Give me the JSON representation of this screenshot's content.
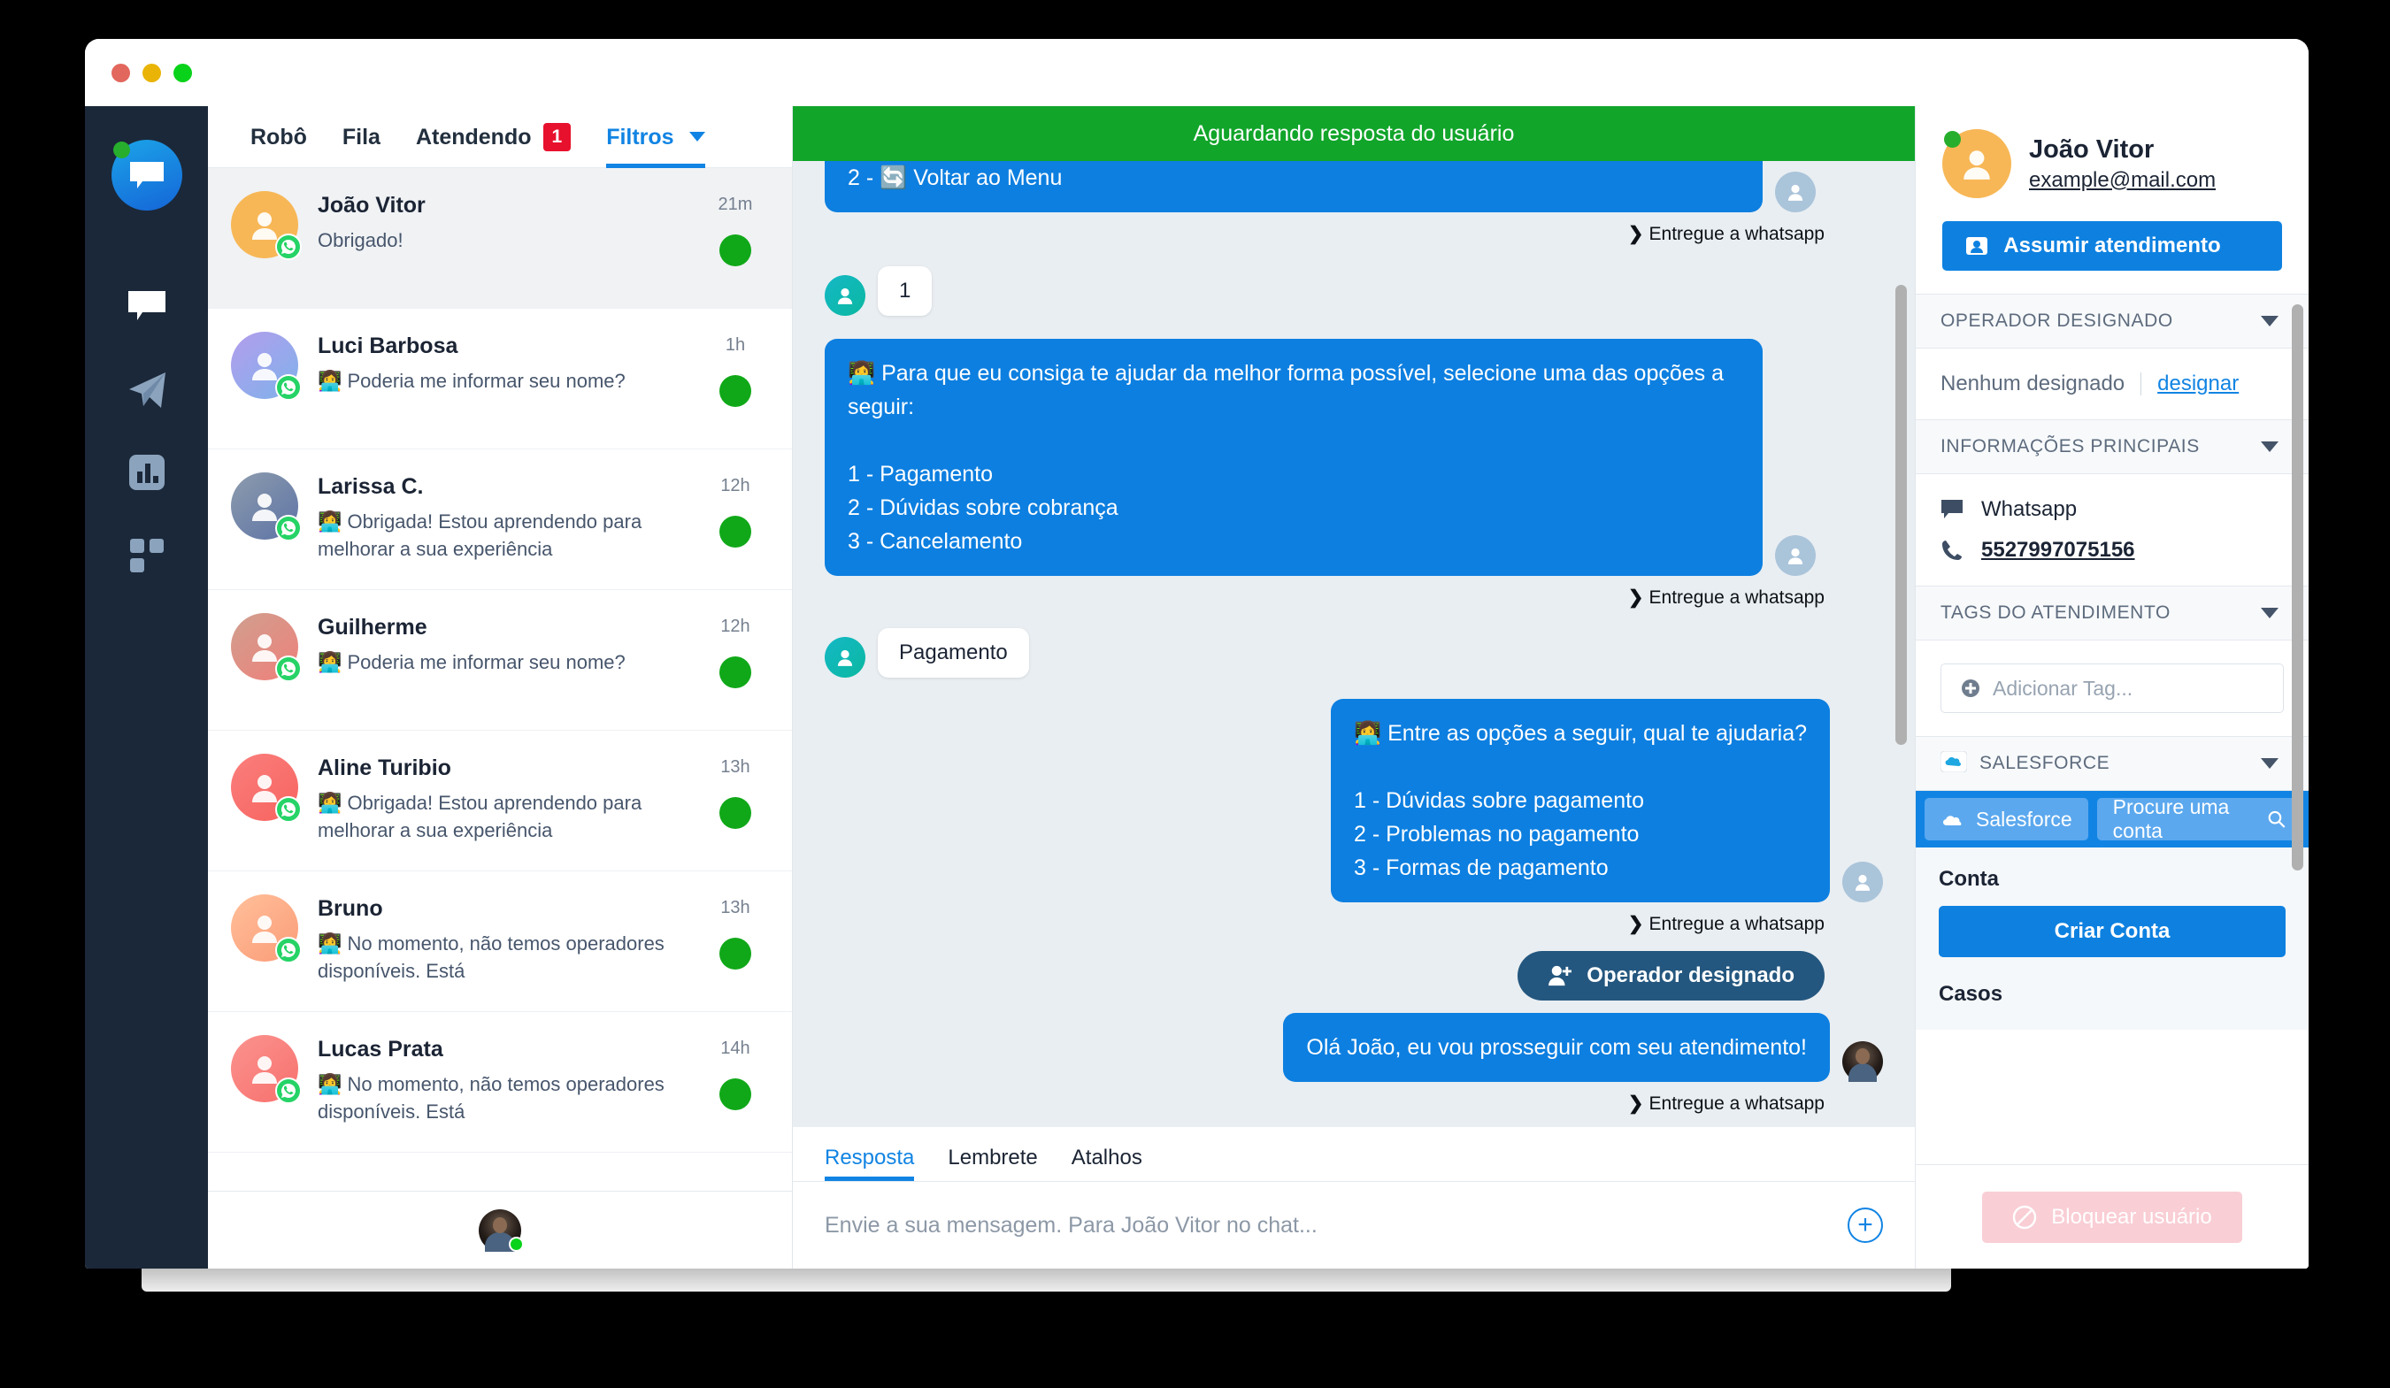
{
  "window": {
    "traffic_lights": [
      "close",
      "minimize",
      "maximize"
    ]
  },
  "rail": {
    "logo_icon": "chat-logo-icon",
    "items": [
      {
        "icon": "chat-bubble-icon",
        "name": "nav-chat"
      },
      {
        "icon": "paper-plane-icon",
        "name": "nav-campaigns"
      },
      {
        "icon": "bar-chart-icon",
        "name": "nav-reports"
      },
      {
        "icon": "apps-grid-icon",
        "name": "nav-apps"
      }
    ]
  },
  "tabs": [
    {
      "label": "Robô",
      "active": false,
      "badge": ""
    },
    {
      "label": "Fila",
      "active": false,
      "badge": ""
    },
    {
      "label": "Atendendo",
      "active": false,
      "badge": "1"
    },
    {
      "label": "Filtros",
      "active": true,
      "badge": "",
      "caret": true
    }
  ],
  "conversations": [
    {
      "name": "João Vitor",
      "snippet": "Obrigado!",
      "time": "21m",
      "selected": true,
      "avatar_color": "#f7b756",
      "channel": "whatsapp",
      "status_color": "#10a818"
    },
    {
      "name": "Luci Barbosa",
      "snippet": "👩‍💻 Poderia me informar seu nome?",
      "time": "1h",
      "selected": false,
      "avatar_color": "#9aa5e8",
      "channel": "whatsapp",
      "status_color": "#10a818"
    },
    {
      "name": "Larissa C.",
      "snippet": "👩‍💻 Obrigada! Estou aprendendo para melhorar a sua experiência",
      "time": "12h",
      "selected": false,
      "avatar_color": "#6f7f9e",
      "channel": "whatsapp",
      "status_color": "#10a818"
    },
    {
      "name": "Guilherme",
      "snippet": "👩‍💻 Poderia me informar seu nome?",
      "time": "12h",
      "selected": false,
      "avatar_color": "#d98a86",
      "channel": "whatsapp",
      "status_color": "#10a818"
    },
    {
      "name": "Aline Turibio",
      "snippet": "👩‍💻 Obrigada! Estou aprendendo para melhorar a sua experiência",
      "time": "13h",
      "selected": false,
      "avatar_color": "#f8766f",
      "channel": "whatsapp",
      "status_color": "#10a818"
    },
    {
      "name": "Bruno",
      "snippet": "👩‍💻 No momento, não temos operadores disponíveis. Está",
      "time": "13h",
      "selected": false,
      "avatar_color": "#fbab82",
      "channel": "whatsapp",
      "status_color": "#10a818"
    },
    {
      "name": "Lucas Prata",
      "snippet": "👩‍💻 No momento, não temos operadores disponíveis. Está",
      "time": "14h",
      "selected": false,
      "avatar_color": "#f98e8b",
      "channel": "whatsapp",
      "status_color": "#10a818"
    }
  ],
  "chat": {
    "status_banner": "Aguardando resposta do usuário",
    "delivery_label": "Entregue a whatsapp",
    "messages": [
      {
        "type": "bot",
        "text": "2 - 🔄 Voltar ao Menu",
        "clipped": true,
        "delivery": "Entregue a whatsapp"
      },
      {
        "type": "user_pill",
        "text": "1"
      },
      {
        "type": "bot",
        "text": "👩‍💻 Para que eu consiga te ajudar da melhor forma possível, selecione uma das opções a seguir:\n\n1 - Pagamento\n2 - Dúvidas sobre cobrança\n3 - Cancelamento",
        "delivery": "Entregue a whatsapp"
      },
      {
        "type": "user_pill",
        "text": "Pagamento"
      },
      {
        "type": "bot_right",
        "text": "👩‍💻 Entre as opções a seguir, qual te ajudaria?\n\n1 - Dúvidas sobre pagamento\n2 - Problemas no pagamento\n3 - Formas de pagamento",
        "delivery": "Entregue a whatsapp"
      },
      {
        "type": "system",
        "text": "Operador designado",
        "icon": "user-plus-icon"
      },
      {
        "type": "operator",
        "text": "Olá João, eu vou prosseguir com seu atendimento!",
        "delivery": "Entregue a whatsapp"
      }
    ]
  },
  "compose": {
    "tabs": [
      {
        "label": "Resposta",
        "active": true
      },
      {
        "label": "Lembrete",
        "active": false
      },
      {
        "label": "Atalhos",
        "active": false
      }
    ],
    "placeholder": "Envie a sua mensagem. Para João Vitor no chat...",
    "attach_icon": "plus-circle-icon"
  },
  "sidebar": {
    "contact_name": "João Vitor",
    "contact_email": "example@mail.com",
    "assume_button": "Assumir atendimento",
    "sections": {
      "operator": {
        "title": "OPERADOR DESIGNADO",
        "none_label": "Nenhum designado",
        "assign_link": "designar"
      },
      "info": {
        "title": "INFORMAÇÕES PRINCIPAIS",
        "channel_label": "Whatsapp",
        "phone": "5527997075156"
      },
      "tags": {
        "title": "TAGS DO ATENDIMENTO",
        "add_placeholder": "Adicionar Tag..."
      },
      "salesforce": {
        "title": "SALESFORCE",
        "chip_label": "Salesforce",
        "search_placeholder": "Procure uma conta",
        "account_label": "Conta",
        "create_button": "Criar Conta",
        "cases_label": "Casos"
      }
    },
    "block_button": "Bloquear usuário"
  },
  "colors": {
    "brand_blue": "#1184e3",
    "bubble_blue": "#0d7fe0",
    "status_green": "#11a52a",
    "badge_red": "#e8112d",
    "rail_dark": "#1b2839",
    "chat_bg": "#e9eef2",
    "system_navy": "#24577f",
    "block_pink": "#f9ced5"
  }
}
